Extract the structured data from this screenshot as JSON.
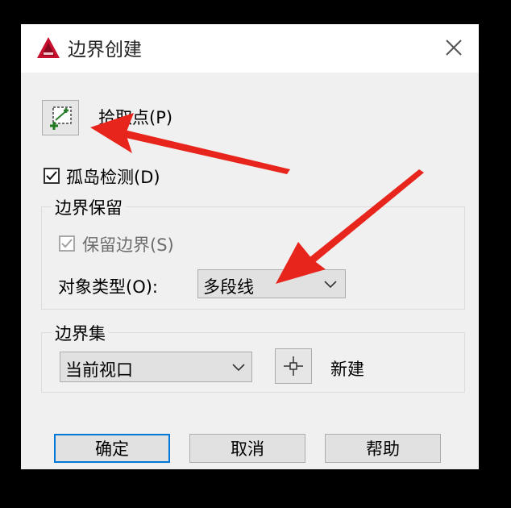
{
  "dialog": {
    "title": "边界创建",
    "icon": "autocad-icon",
    "close_icon": "close-icon"
  },
  "pick_points": {
    "label": "拾取点(P)",
    "icon": "pick-points-icon"
  },
  "island_detection": {
    "label": "孤岛检测(D)",
    "checked": true
  },
  "boundary_retention": {
    "group_label": "边界保留",
    "retain_label": "保留边界(S)",
    "retain_checked": true,
    "retain_enabled": false,
    "object_type_label": "对象类型(O):",
    "object_type_value": "多段线"
  },
  "boundary_set": {
    "group_label": "边界集",
    "value": "当前视口",
    "new_icon": "select-objects-icon",
    "new_label": "新建"
  },
  "buttons": {
    "ok": "确定",
    "cancel": "取消",
    "help": "帮助"
  },
  "annotation_color": "#e8251c"
}
